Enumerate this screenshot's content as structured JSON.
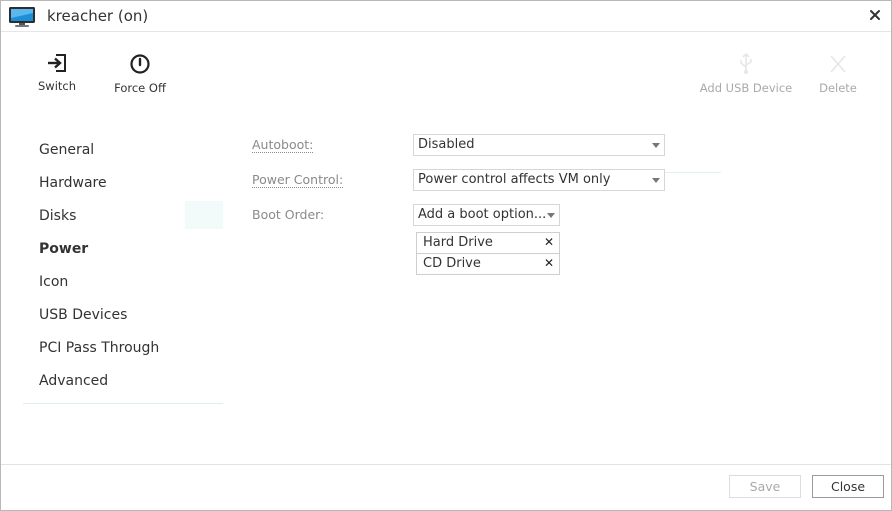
{
  "window": {
    "title": "kreacher (on)"
  },
  "toolbar": {
    "switch_label": "Switch",
    "force_off_label": "Force Off",
    "add_usb_label": "Add USB Device",
    "delete_label": "Delete"
  },
  "sidebar": {
    "items": [
      {
        "label": "General",
        "active": false
      },
      {
        "label": "Hardware",
        "active": false
      },
      {
        "label": "Disks",
        "active": false
      },
      {
        "label": "Power",
        "active": true
      },
      {
        "label": "Icon",
        "active": false
      },
      {
        "label": "USB Devices",
        "active": false
      },
      {
        "label": "PCI Pass Through",
        "active": false
      },
      {
        "label": "Advanced",
        "active": false
      }
    ]
  },
  "form": {
    "autoboot": {
      "label": "Autoboot:",
      "value": "Disabled"
    },
    "power_control": {
      "label": "Power Control:",
      "value": "Power control affects VM only"
    },
    "boot_order": {
      "label": "Boot Order:",
      "placeholder": "Add a boot option...",
      "items": [
        "Hard Drive",
        "CD Drive"
      ]
    }
  },
  "footer": {
    "save_label": "Save",
    "close_label": "Close"
  },
  "colors": {
    "accent_monitor": "#1e8fd6",
    "text": "#333333",
    "muted": "#8a8a8a",
    "disabled": "#a9a9a9"
  }
}
